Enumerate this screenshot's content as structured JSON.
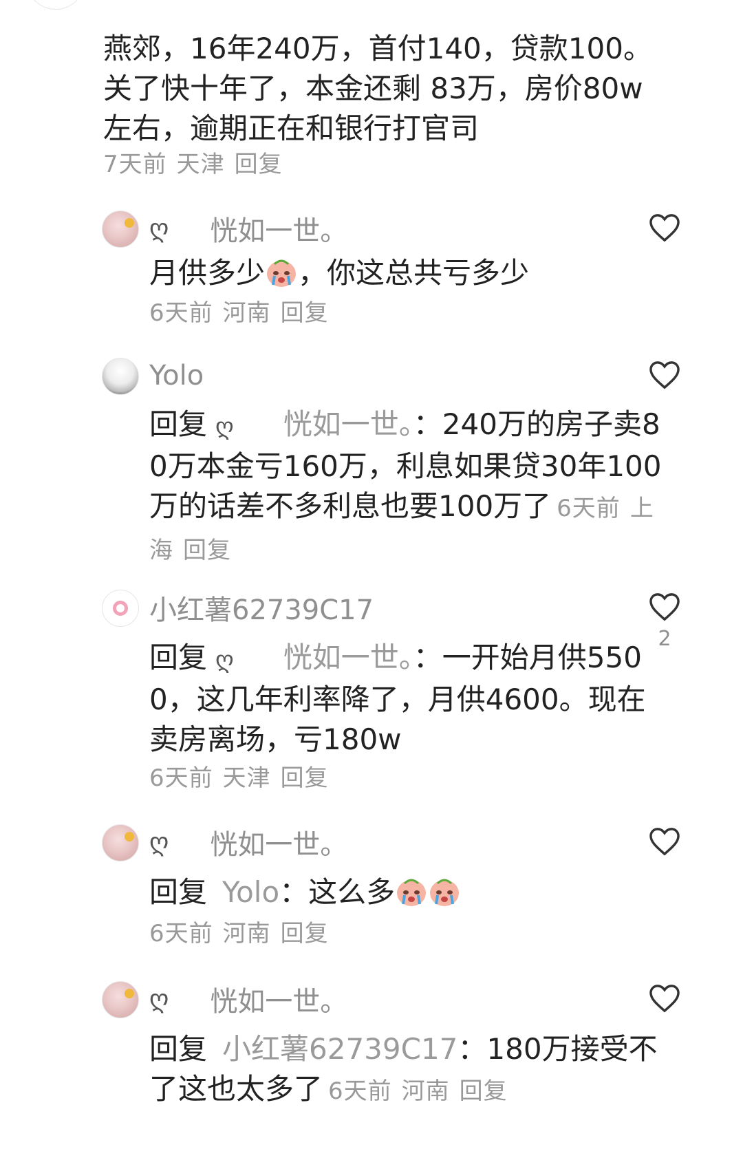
{
  "comments": [
    {
      "body": "燕郊，16年240万，首付140，贷款100。关了快十年了，本金还剩 83万，房价80w左右，逾期正在和银行打官司",
      "time": "7天前",
      "location": "天津",
      "reply_label": "回复"
    },
    {
      "author_glyph": "ღ",
      "author": "恍如一世。",
      "body": "月供多少",
      "body_emoji": "crying-face-emoji",
      "body_suffix": "，你这总共亏多少",
      "time": "6天前",
      "location": "河南",
      "reply_label": "回复"
    },
    {
      "author": "Yolo",
      "reply_prefix": "回复",
      "reply_target_glyph": "ღ",
      "reply_target": "恍如一世。",
      "reply_separator": "：",
      "body": "240万的房子卖80万本金亏160万，利息如果贷30年100万的话差不多利息也要100万了",
      "time": "6天前",
      "location": "上海",
      "reply_label": "回复"
    },
    {
      "author": "小红薯62739C17",
      "reply_prefix": "回复",
      "reply_target_glyph": "ღ",
      "reply_target": "恍如一世。",
      "reply_separator": "：",
      "body": "一开始月供5500，这几年利率降了，月供4600。现在卖房离场，亏180w",
      "time": "6天前",
      "location": "天津",
      "reply_label": "回复",
      "like_count": "2"
    },
    {
      "author_glyph": "ღ",
      "author": "恍如一世。",
      "reply_prefix": "回复",
      "reply_target": "Yolo",
      "reply_separator": "：",
      "body": "这么多",
      "time": "6天前",
      "location": "河南",
      "reply_label": "回复"
    },
    {
      "author_glyph": "ღ",
      "author": "恍如一世。",
      "reply_prefix": "回复",
      "reply_target": "小红薯62739C17",
      "reply_separator": "：",
      "body": "180万接受不了这也太多了",
      "time": "6天前",
      "location": "河南",
      "reply_label": "回复"
    }
  ],
  "icons": {
    "like": "heart-outline-icon",
    "emoji": "crying-face-emoji"
  },
  "colors": {
    "text": "#222222",
    "secondary": "#999999",
    "heart_stroke": "#333333"
  }
}
